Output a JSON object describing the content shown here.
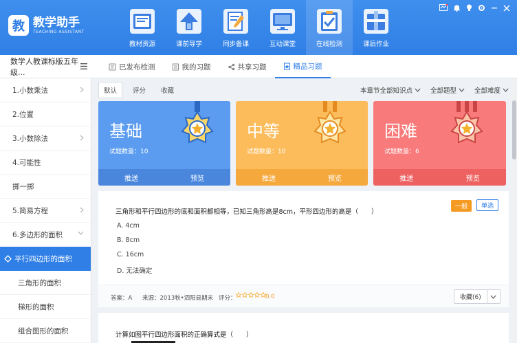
{
  "app": {
    "logo_char": "教",
    "title": "教学助手",
    "subtitle": "TEACHING ASSISTANT"
  },
  "nav": [
    {
      "label": "教材资源",
      "icon": "textbook-resources-icon"
    },
    {
      "label": "课前导学",
      "icon": "pre-class-guide-icon"
    },
    {
      "label": "同步备课",
      "icon": "lesson-prep-icon"
    },
    {
      "label": "互动课堂",
      "icon": "interactive-class-icon"
    },
    {
      "label": "在线检测",
      "icon": "online-test-icon",
      "active": true
    },
    {
      "label": "课后作业",
      "icon": "homework-icon"
    }
  ],
  "course_selector": "数学人教课标版五年级...",
  "tabs": [
    {
      "label": "已发布检测",
      "icon": "published-test-icon"
    },
    {
      "label": "我的习题",
      "icon": "my-exercise-icon"
    },
    {
      "label": "共享习题",
      "icon": "shared-exercise-icon"
    },
    {
      "label": "精品习题",
      "icon": "premium-exercise-icon",
      "active": true
    }
  ],
  "sidebar": [
    {
      "label": "1.小数乘法",
      "chevron": "right"
    },
    {
      "label": "2.位置"
    },
    {
      "label": "3.小数除法",
      "chevron": "right"
    },
    {
      "label": "4.可能性"
    },
    {
      "label": "掷一掷"
    },
    {
      "label": "5.简易方程",
      "chevron": "right"
    },
    {
      "label": "6.多边形的面积",
      "chevron": "down"
    },
    {
      "label": "平行四边形的面积",
      "active": true
    },
    {
      "label": "三角形的面积",
      "sub": true
    },
    {
      "label": "梯形的面积",
      "sub": true
    },
    {
      "label": "组合图形的面积",
      "sub": true
    }
  ],
  "sort": [
    {
      "label": "默认",
      "active": true
    },
    {
      "label": "评分"
    },
    {
      "label": "收藏"
    }
  ],
  "filters": [
    "本章节全部知识点",
    "全部题型",
    "全部难度"
  ],
  "difficulty_cards": [
    {
      "title": "基础",
      "count_label": "试题数量：10",
      "push": "推送",
      "preview": "预览",
      "color": "#5b9cf0",
      "bar": "#4a87dc"
    },
    {
      "title": "中等",
      "count_label": "试题数量：10",
      "push": "推送",
      "preview": "预览",
      "color": "#fcbc5c",
      "bar": "#f5a83c"
    },
    {
      "title": "困难",
      "count_label": "试题数量：6",
      "push": "推送",
      "preview": "预览",
      "color": "#f87a7a",
      "bar": "#ee6161"
    }
  ],
  "question1": {
    "stem": "三角形和平行四边形的底和面积都相等，已知三角形高是8cm，平形四边形的高是（　　）",
    "options": [
      "A. 4cm",
      "B. 8cm",
      "C. 16cm",
      "D. 无法确定"
    ],
    "level": "一般",
    "type": "单选",
    "answer": "答案：A",
    "source": "来源：2013秋•泗阳县期末",
    "rating_label": "评分：",
    "rating": 0,
    "stars_total": 5,
    "score": "0.0",
    "favorite": "收藏(6)"
  },
  "question2": {
    "stem": "计算如图平行四边形面积的正确算式是（　　）"
  }
}
